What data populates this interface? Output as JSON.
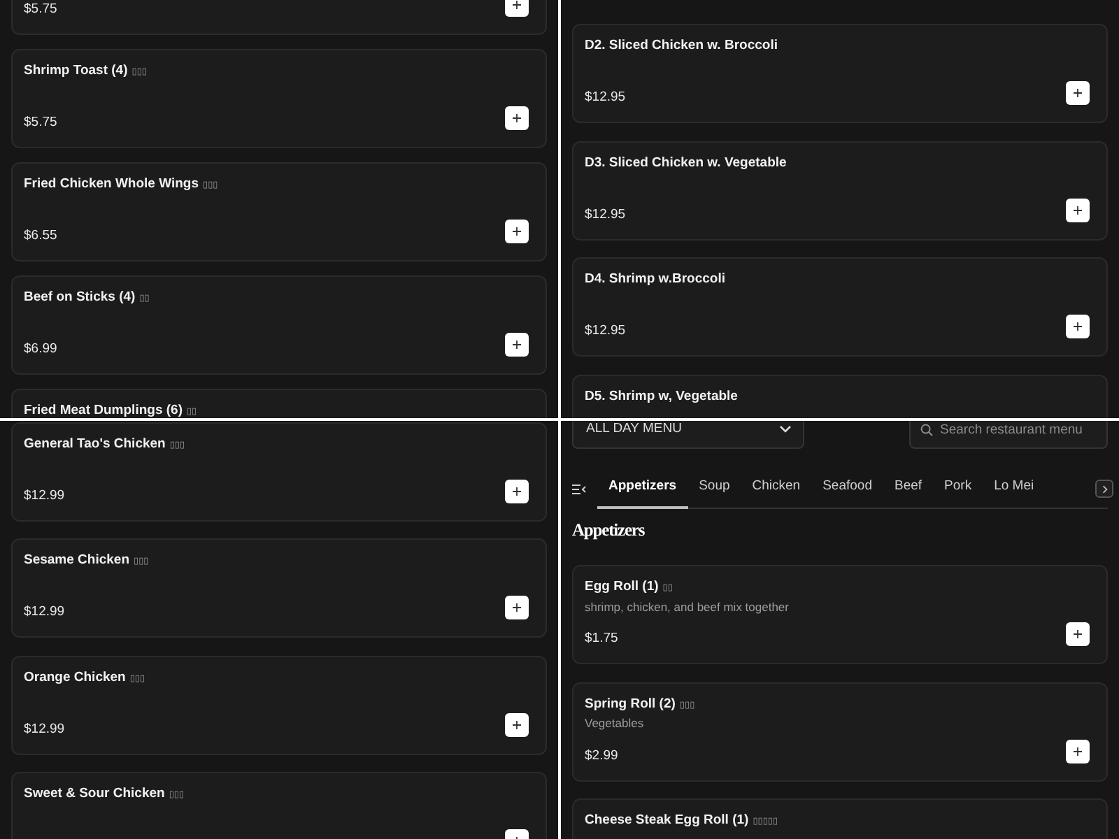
{
  "panels": [
    {
      "kind": "item_list",
      "items": [
        {
          "price": "$5.75"
        },
        {
          "name": "Shrimp Toast (4)",
          "alt_name": "▯▯▯",
          "price": "$5.75"
        },
        {
          "name": "Fried Chicken Whole Wings",
          "alt_name": "▯▯▯",
          "price": "$6.55"
        },
        {
          "name": "Beef on Sticks (4)",
          "alt_name": "▯▯",
          "price": "$6.99"
        },
        {
          "name": "Fried Meat Dumplings (6)",
          "alt_name": "▯▯"
        }
      ]
    },
    {
      "kind": "item_list",
      "items": [
        {
          "name": "D2. Sliced Chicken w. Broccoli",
          "price": "$12.95"
        },
        {
          "name": "D3. Sliced Chicken w. Vegetable",
          "price": "$12.95"
        },
        {
          "name": "D4. Shrimp w.Broccoli",
          "price": "$12.95"
        },
        {
          "name": "D5. Shrimp w, Vegetable"
        }
      ]
    },
    {
      "kind": "item_list",
      "items": [
        {
          "name": "General Tao's Chicken",
          "alt_name": "▯▯▯",
          "price": "$12.99"
        },
        {
          "name": "Sesame Chicken",
          "alt_name": "▯▯▯",
          "price": "$12.99"
        },
        {
          "name": "Orange Chicken",
          "alt_name": "▯▯▯",
          "price": "$12.99"
        },
        {
          "name": "Sweet & Sour Chicken",
          "alt_name": "▯▯▯"
        }
      ]
    },
    {
      "kind": "menu_home",
      "menu_select": {
        "value": "ALL DAY MENU"
      },
      "search": {
        "placeholder": "Search restaurant menu"
      },
      "tabs": [
        {
          "label": "Appetizers",
          "selected": true
        },
        {
          "label": "Soup",
          "selected": false
        },
        {
          "label": "Chicken",
          "selected": false
        },
        {
          "label": "Seafood",
          "selected": false
        },
        {
          "label": "Beef",
          "selected": false
        },
        {
          "label": "Pork",
          "selected": false
        },
        {
          "label": "Lo Mei",
          "selected": false
        }
      ],
      "section_title": "Appetizers",
      "items": [
        {
          "name": "Egg Roll (1)",
          "alt_name": "▯▯",
          "description": "shrimp, chicken, and beef mix together",
          "price": "$1.75"
        },
        {
          "name": "Spring Roll (2)",
          "alt_name": "▯▯▯",
          "description": "Vegetables",
          "price": "$2.99"
        },
        {
          "name": "Cheese Steak Egg Roll (1)",
          "alt_name": "▯▯▯▯▯"
        }
      ]
    }
  ]
}
